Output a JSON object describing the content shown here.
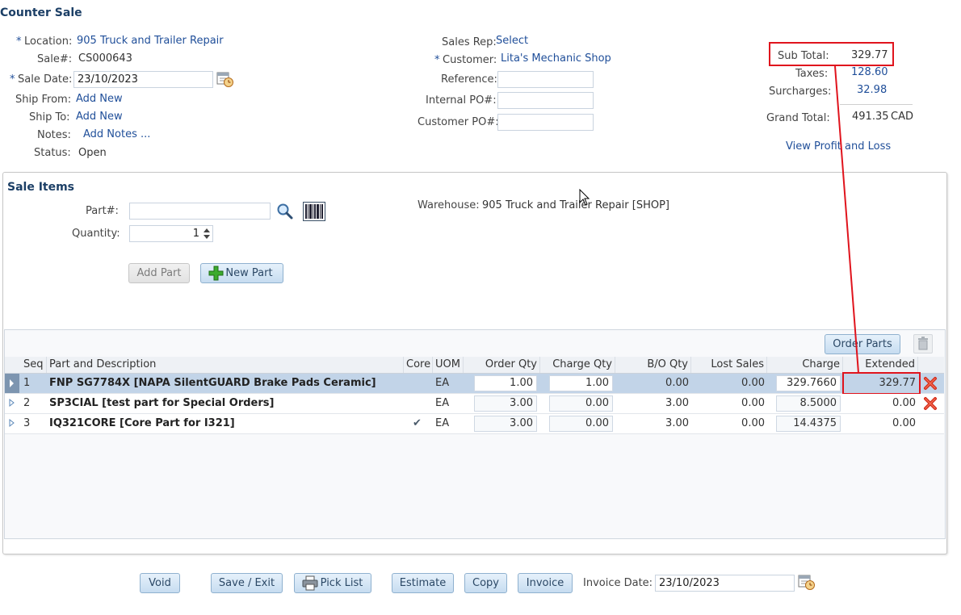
{
  "header": {
    "title": "Counter Sale"
  },
  "left_fields": {
    "location_label": "Location:",
    "location_value": "905 Truck and Trailer Repair",
    "sale_no_label": "Sale#:",
    "sale_no_value": "CS000643",
    "sale_date_label": "Sale Date:",
    "sale_date_value": "23/10/2023",
    "ship_from_label": "Ship From:",
    "ship_from_value": "Add New",
    "ship_to_label": "Ship To:",
    "ship_to_value": "Add New",
    "notes_label": "Notes:",
    "notes_value": "Add Notes ...",
    "status_label": "Status:",
    "status_value": "Open",
    "required_mark": "*"
  },
  "middle_fields": {
    "sales_rep_label": "Sales Rep:",
    "sales_rep_value": "Select",
    "customer_label": "Customer:",
    "customer_value": "Lita's Mechanic Shop",
    "reference_label": "Reference:",
    "reference_value": "",
    "internal_po_label": "Internal PO#:",
    "internal_po_value": "",
    "customer_po_label": "Customer PO#:",
    "customer_po_value": ""
  },
  "totals": {
    "subtotal_label": "Sub Total:",
    "subtotal_value": "329.77",
    "taxes_label": "Taxes:",
    "taxes_value": "128.60",
    "surcharges_label": "Surcharges:",
    "surcharges_value": "32.98",
    "grand_total_label": "Grand Total:",
    "grand_total_value": "491.35",
    "currency": "CAD",
    "profit_link": "View Profit and Loss"
  },
  "sale_items": {
    "title": "Sale Items",
    "part_label": "Part#:",
    "part_value": "",
    "quantity_label": "Quantity:",
    "quantity_value": "1",
    "warehouse_label": "Warehouse:",
    "warehouse_value": "905 Truck and Trailer Repair [SHOP]",
    "add_part_button": "Add Part",
    "new_part_button": "New Part",
    "order_parts_button": "Order Parts"
  },
  "grid": {
    "columns": [
      "Seq",
      "Part and Description",
      "Core",
      "UOM",
      "Order Qty",
      "Charge Qty",
      "B/O Qty",
      "Lost Sales",
      "Charge",
      "Extended"
    ],
    "rows": [
      {
        "seq": "1",
        "desc": "FNP SG7784X [NAPA SilentGUARD Brake Pads Ceramic]",
        "core": "",
        "uom": "EA",
        "order_qty": "1.00",
        "charge_qty": "1.00",
        "bo_qty": "0.00",
        "lost_sales": "0.00",
        "charge": "329.7660",
        "extended": "329.77"
      },
      {
        "seq": "2",
        "desc": "SP3CIAL [test part for Special Orders]",
        "core": "",
        "uom": "EA",
        "order_qty": "3.00",
        "charge_qty": "0.00",
        "bo_qty": "3.00",
        "lost_sales": "0.00",
        "charge": "8.5000",
        "extended": "0.00"
      },
      {
        "seq": "3",
        "desc": "IQ321CORE [Core Part for I321]",
        "core": "✔",
        "uom": "EA",
        "order_qty": "3.00",
        "charge_qty": "0.00",
        "bo_qty": "3.00",
        "lost_sales": "0.00",
        "charge": "14.4375",
        "extended": "0.00"
      }
    ]
  },
  "footer": {
    "void": "Void",
    "save_exit": "Save / Exit",
    "pick_list": "Pick List",
    "estimate": "Estimate",
    "copy": "Copy",
    "invoice": "Invoice",
    "invoice_date_label": "Invoice Date:",
    "invoice_date_value": "23/10/2023"
  },
  "colors": {
    "accent": "#1f4e99",
    "highlight": "#e0141d",
    "selected_row": "#c2d4e8"
  }
}
